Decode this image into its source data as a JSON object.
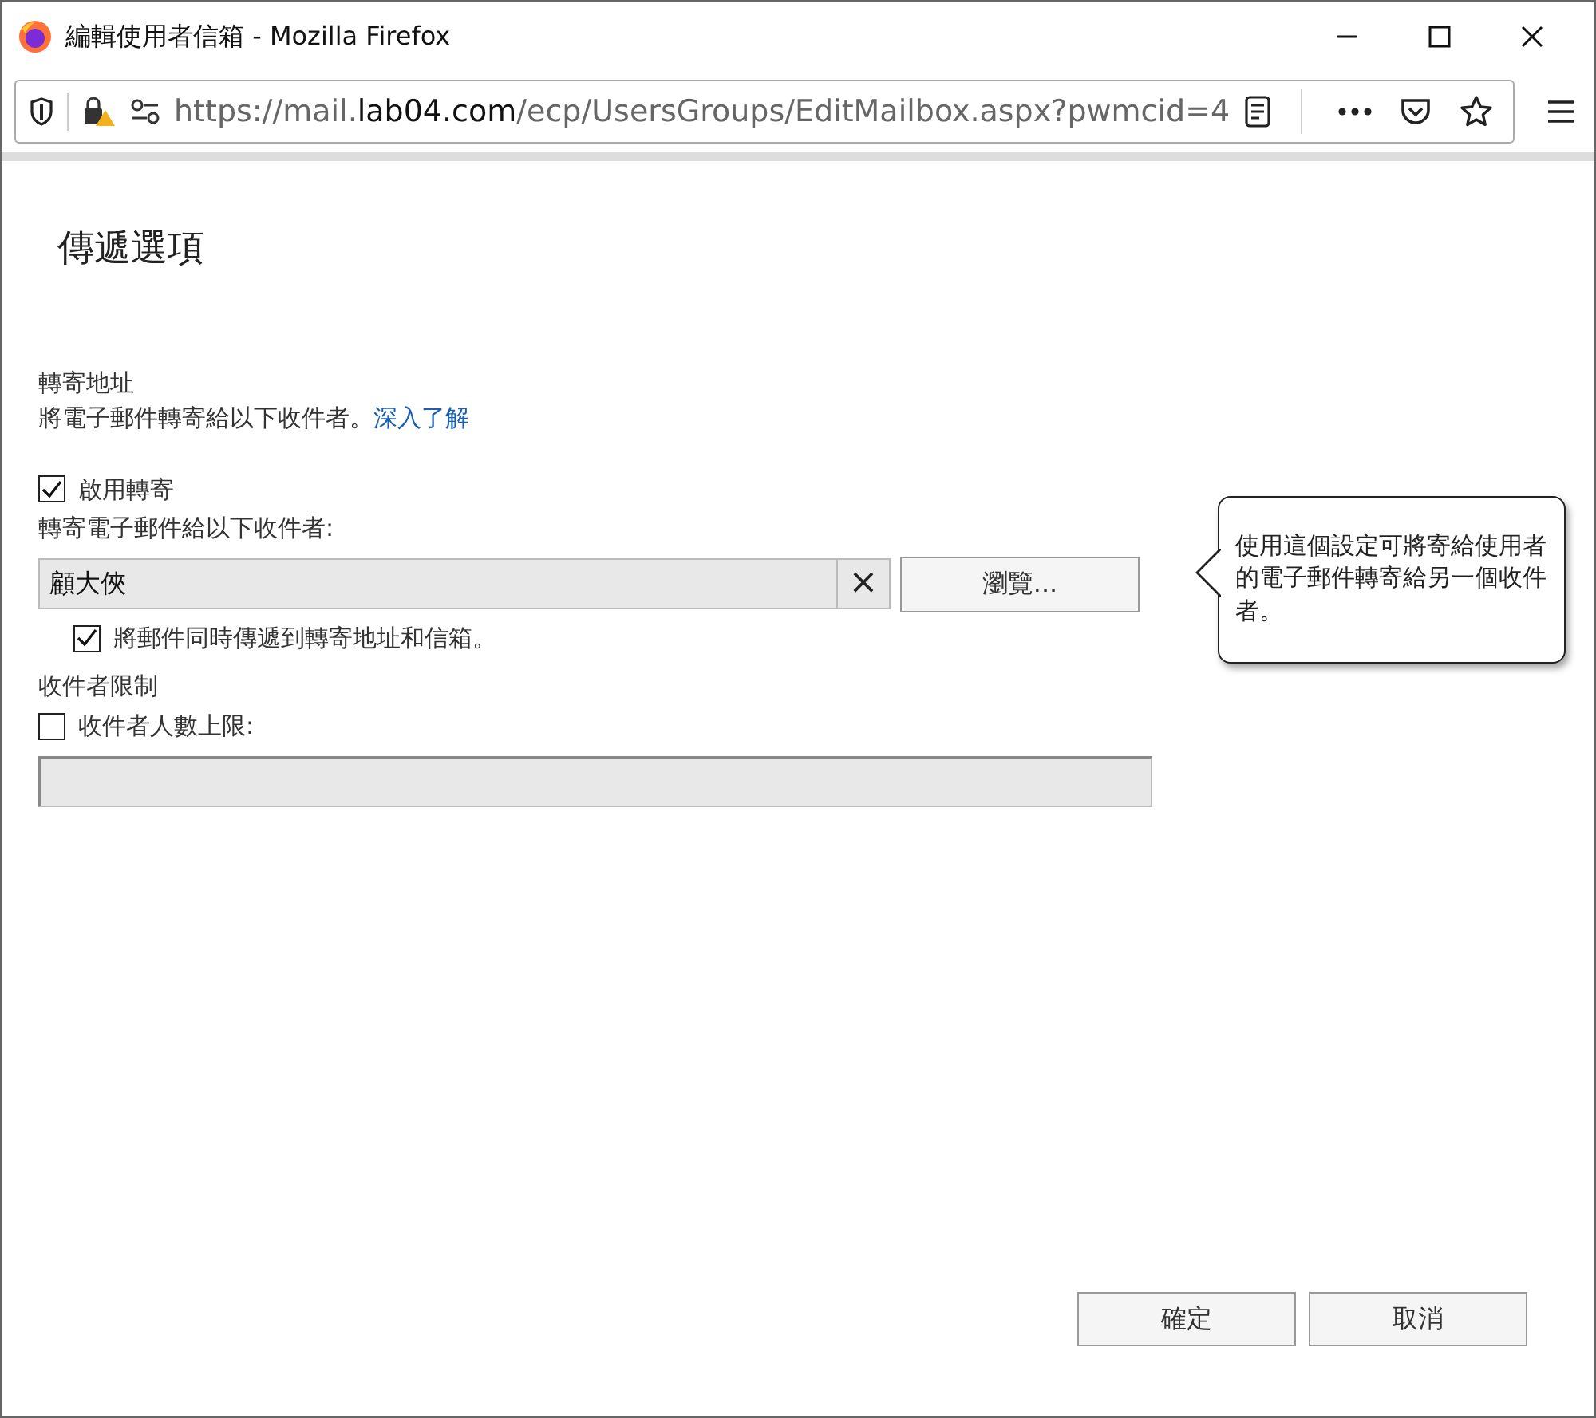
{
  "window": {
    "title": "編輯使用者信箱 - Mozilla Firefox"
  },
  "address_bar": {
    "url": "https://mail.**lab04.com**/ecp/UsersGroups/EditMailbox.aspx?pwmcid=4"
  },
  "page": {
    "heading": "傳遞選項",
    "forwarding": {
      "title": "轉寄地址",
      "description": "將電子郵件轉寄給以下收件者。",
      "link": "深入了解",
      "enable": {
        "label": "啟用轉寄",
        "checked": true
      },
      "recipient_label": "轉寄電子郵件給以下收件者:",
      "recipient_value": "顧大俠",
      "clear": "×",
      "browse": "瀏覽...",
      "deliver_both": {
        "label": "將郵件同時傳遞到轉寄地址和信箱。",
        "checked": true
      }
    },
    "tooltip": "使用這個設定可將寄給使用者的電子郵件轉寄給另一個收件者。",
    "limits": {
      "title": "收件者限制",
      "max_recipients": {
        "label": "收件者人數上限:",
        "checked": false
      }
    },
    "buttons": [
      {
        "label": "確定"
      },
      {
        "label": "取消"
      }
    ]
  }
}
